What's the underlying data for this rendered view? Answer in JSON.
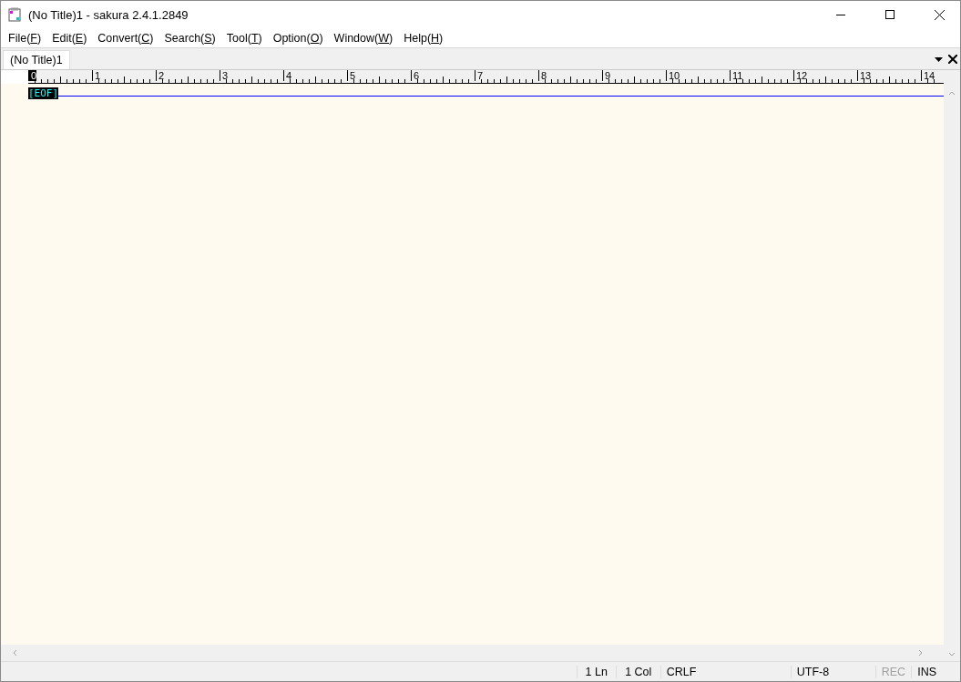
{
  "window": {
    "title": "(No Title)1 - sakura 2.4.1.2849"
  },
  "menu": [
    {
      "before": "File(",
      "key": "F",
      "after": ")"
    },
    {
      "before": "Edit(",
      "key": "E",
      "after": ")"
    },
    {
      "before": "Convert(",
      "key": "C",
      "after": ")"
    },
    {
      "before": "Search(",
      "key": "S",
      "after": ")"
    },
    {
      "before": "Tool(",
      "key": "T",
      "after": ")"
    },
    {
      "before": "Option(",
      "key": "O",
      "after": ")"
    },
    {
      "before": "Window(",
      "key": "W",
      "after": ")"
    },
    {
      "before": "Help(",
      "key": "H",
      "after": ")"
    }
  ],
  "tabs": [
    {
      "label": "(No Title)1",
      "selected": true
    }
  ],
  "ruler": {
    "labels": [
      {
        "text": "0",
        "cursor": true
      },
      {
        "text": "1",
        "cursor": false
      },
      {
        "text": "2",
        "cursor": false
      },
      {
        "text": "3",
        "cursor": false
      },
      {
        "text": "4",
        "cursor": false
      },
      {
        "text": "5",
        "cursor": false
      },
      {
        "text": "6",
        "cursor": false
      },
      {
        "text": "7",
        "cursor": false
      },
      {
        "text": "8",
        "cursor": false
      },
      {
        "text": "9",
        "cursor": false
      },
      {
        "text": "10",
        "cursor": false
      },
      {
        "text": "11",
        "cursor": false
      },
      {
        "text": "12",
        "cursor": false
      },
      {
        "text": "13",
        "cursor": false
      },
      {
        "text": "14",
        "cursor": false
      }
    ]
  },
  "editor": {
    "eof": "[EOF]"
  },
  "status_bar": [
    {
      "text": "1 Ln",
      "disabled": false
    },
    {
      "text": "1 Col",
      "disabled": false
    },
    {
      "text": "CRLF",
      "disabled": false
    },
    {
      "text": "UTF-8",
      "disabled": false
    },
    {
      "text": "REC",
      "disabled": true
    },
    {
      "text": "INS",
      "disabled": false
    }
  ]
}
